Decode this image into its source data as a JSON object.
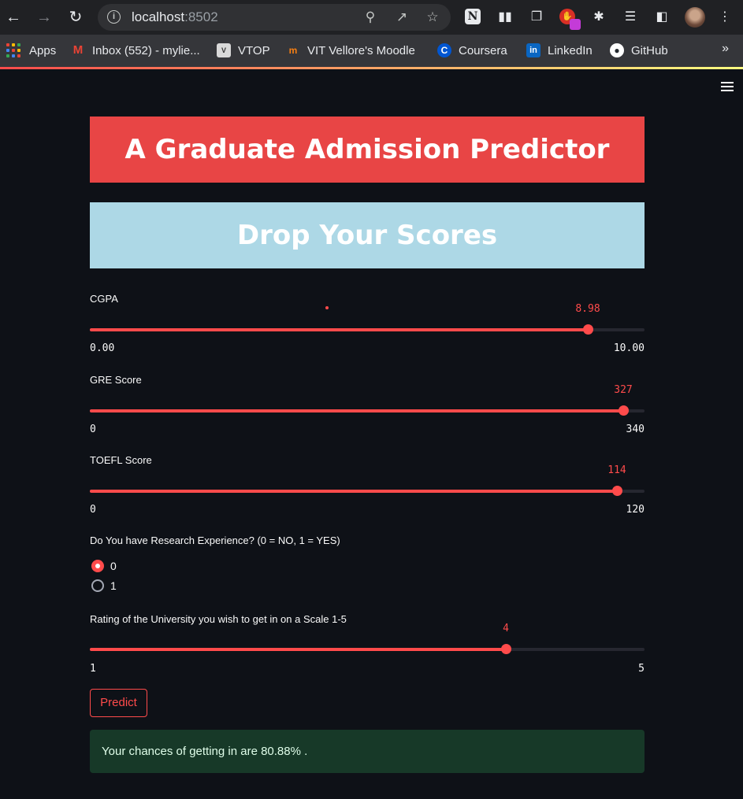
{
  "browser": {
    "url_host": "localhost",
    "url_port": ":8502",
    "bookmarks": [
      {
        "label": "Apps"
      },
      {
        "label": "Inbox (552) - mylie..."
      },
      {
        "label": "VTOP"
      },
      {
        "label": "VIT Vellore's Moodle"
      },
      {
        "label": "Coursera"
      },
      {
        "label": "LinkedIn"
      },
      {
        "label": "GitHub"
      }
    ],
    "more_label": "»"
  },
  "app": {
    "title": "A Graduate Admission Predictor",
    "subtitle": "Drop Your Scores",
    "title_bg": "#e84545",
    "subtitle_bg": "#add8e6",
    "accent": "#ff4b4b"
  },
  "sliders": [
    {
      "label": "CGPA",
      "value": "8.98",
      "min": "0.00",
      "max": "10.00",
      "fraction": 0.898
    },
    {
      "label": "GRE Score",
      "value": "327",
      "min": "0",
      "max": "340",
      "fraction": 0.9618
    },
    {
      "label": "TOEFL Score",
      "value": "114",
      "min": "0",
      "max": "120",
      "fraction": 0.95
    },
    {
      "label": "Rating of the University you wish to get in on a Scale 1-5",
      "value": "4",
      "min": "1",
      "max": "5",
      "fraction": 0.75
    }
  ],
  "research": {
    "label": "Do You have Research Experience? (0 = NO, 1 = YES)",
    "options": [
      "0",
      "1"
    ],
    "selected": "0"
  },
  "predict_label": "Predict",
  "result_text": "Your chances of getting in are 80.88% ."
}
